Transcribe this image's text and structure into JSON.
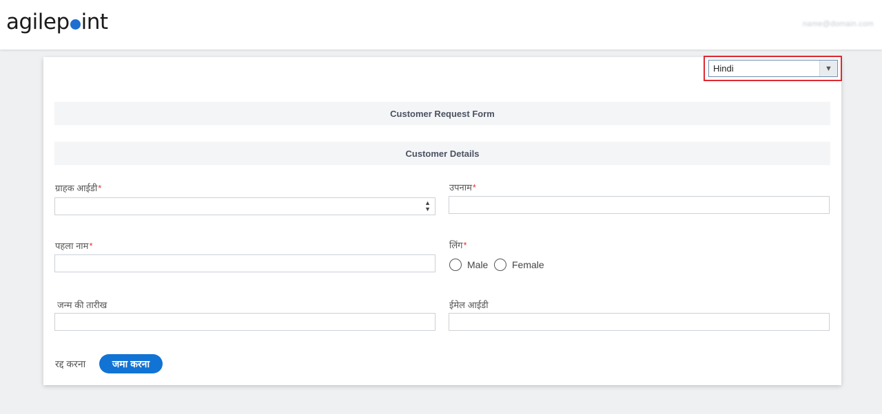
{
  "brand": {
    "logo_left": "agilep",
    "logo_right": "int"
  },
  "header": {
    "user_name": "name@domain.com"
  },
  "language": {
    "selected": "Hindi"
  },
  "form": {
    "title": "Customer Request Form",
    "section": "Customer Details",
    "fields": {
      "customer_id": "ग्राहक आईडी",
      "last_name": "उपनाम",
      "first_name": "पहला नाम",
      "gender": "लिंग",
      "dob": "जन्म की तारीख",
      "email": "ईमेल आईडी"
    },
    "required_mark": "*",
    "gender_options": {
      "male": "Male",
      "female": "Female"
    },
    "buttons": {
      "cancel": "रद्द करना",
      "submit": "जमा करना"
    }
  },
  "icons": {
    "dropdown": "chevron-down-icon",
    "stepper": "stepper-icon",
    "radio": "radio-icon"
  },
  "colors": {
    "accent": "#1173d4",
    "highlight_border": "#e0282f",
    "required": "#d9342b",
    "logo_dot": "#1f6fd1"
  }
}
